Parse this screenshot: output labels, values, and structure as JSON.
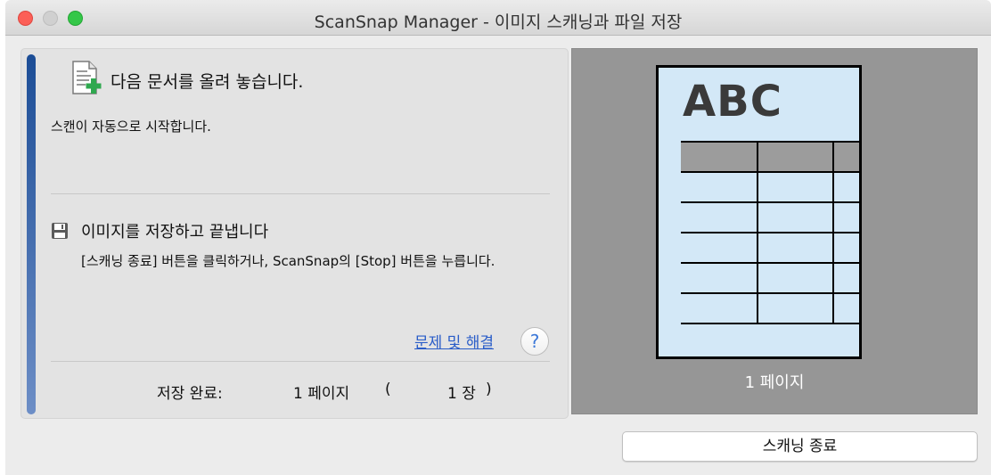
{
  "window": {
    "title": "ScanSnap Manager - 이미지 스캐닝과 파일 저장"
  },
  "progress": {
    "fraction": 1.0,
    "color": "#1c4d96"
  },
  "step1": {
    "icon": "document-add-icon",
    "title": "다음 문서를 올려 놓습니다.",
    "description": "스캔이 자동으로 시작합니다."
  },
  "step2": {
    "icon": "save-disk-icon",
    "title": "이미지를 저장하고 끝냅니다",
    "description": "[스캐닝 종료] 버튼을 클릭하거나, ScanSnap의 [Stop] 버튼을 누릅니다."
  },
  "help": {
    "link_label": "문제 및 해결",
    "button_label": "?"
  },
  "status": {
    "saved_label": "저장 완료:",
    "pages_value": "1 페이지",
    "open_paren": "(",
    "sheets_value": "1 장",
    "close_paren": ")"
  },
  "preview": {
    "page_text": "ABC",
    "page_count": "1 페이지",
    "page_color": "#d3e8f7"
  },
  "buttons": {
    "stop_label": "스캐닝 종료"
  }
}
